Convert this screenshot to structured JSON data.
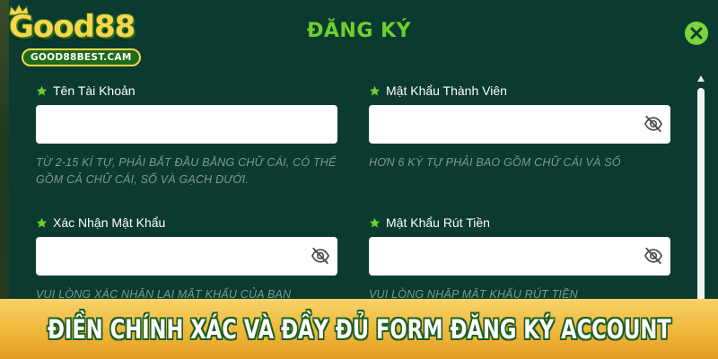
{
  "logo": {
    "wordmark": "Good88",
    "url": "GOOD88BEST.CAM"
  },
  "modal": {
    "title": "ĐĂNG KÝ",
    "close_icon": "close-icon"
  },
  "fields": [
    {
      "label": "Tên Tài Khoản",
      "value": "",
      "type": "text",
      "hint": "TỪ 2-15 KÍ TỰ, PHẢI BẮT ĐẦU BẰNG CHỮ CÁI, CÓ THỂ GỒM CẢ CHỮ CÁI, SỐ VÀ GẠCH DƯỚI."
    },
    {
      "label": "Mật Khẩu Thành Viên",
      "value": "",
      "type": "password",
      "hint": "HƠN 6 KÝ TỰ PHẢI BAO GỒM CHỮ CÁI VÀ SỐ"
    },
    {
      "label": "Xác Nhận Mật Khẩu",
      "value": "",
      "type": "password",
      "hint": "VUI LÒNG XÁC NHẬN LẠI MẬT KHẨU CỦA BẠN"
    },
    {
      "label": "Mật Khẩu Rút Tiền",
      "value": "",
      "type": "password",
      "hint": "VUI LÒNG NHẬP MẬT KHẨU RÚT TIỀN"
    }
  ],
  "banner": {
    "text": "ĐIỀN CHÍNH XÁC VÀ ĐẦY ĐỦ FORM ĐĂNG KÝ ACCOUNT"
  },
  "colors": {
    "modal_bg": "#0b3a31",
    "accent_green": "#6bd12b",
    "banner_gold": "#efb73a",
    "hint_text": "#7a9a93"
  },
  "icons": {
    "required": "star-icon",
    "password_toggle": "eye-slash-icon"
  }
}
